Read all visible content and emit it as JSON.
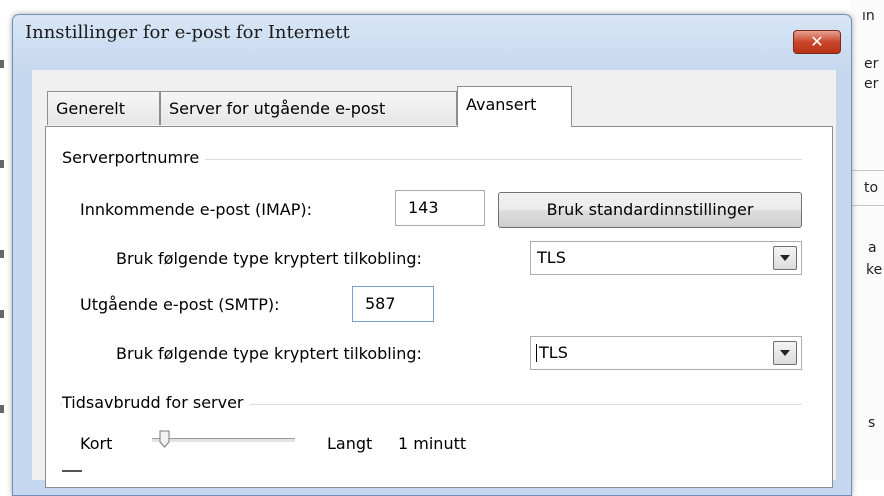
{
  "background": {
    "right_fragments": [
      "ın",
      "er",
      "er",
      "to",
      "a",
      "ke",
      "s"
    ]
  },
  "dialog": {
    "title": "Innstillinger for e-post for Internett",
    "close_glyph": "✕"
  },
  "tabs": [
    {
      "label": "Generelt",
      "active": false
    },
    {
      "label": "Server for utgående e-post",
      "active": false
    },
    {
      "label": "Avansert",
      "active": true
    }
  ],
  "server_ports": {
    "group_title": "Serverportnumre",
    "incoming_label": "Innkommende e-post (IMAP):",
    "incoming_value": "143",
    "default_button": "Bruk standardinnstillinger",
    "incoming_encryption_label": "Bruk følgende type kryptert tilkobling:",
    "incoming_encryption_value": "TLS",
    "outgoing_label": "Utgående e-post (SMTP):",
    "outgoing_value": "587",
    "outgoing_encryption_label": "Bruk følgende type kryptert tilkobling:",
    "outgoing_encryption_value": "TLS"
  },
  "timeout": {
    "group_title": "Tidsavbrudd for server",
    "short_label": "Kort",
    "long_label": "Langt",
    "value_text": "1 minutt",
    "slider_fraction": 0.05
  },
  "colors": {
    "close_button": "#c9462c",
    "title_bar": "#c4d7ee"
  }
}
